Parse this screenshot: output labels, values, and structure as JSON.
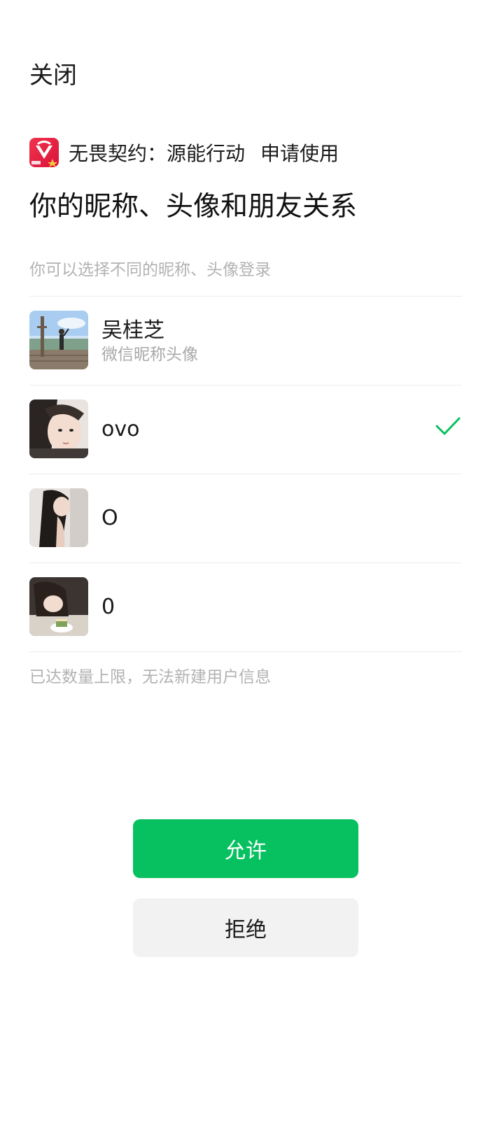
{
  "header": {
    "close_label": "关闭"
  },
  "app": {
    "name": "无畏契约：源能行动",
    "request_label": "申请使用",
    "icon": "valorant-app-icon",
    "icon_color": "#e8223f"
  },
  "title": "你的昵称、头像和朋友关系",
  "hint": "你可以选择不同的昵称、头像登录",
  "profiles": [
    {
      "name": "吴桂芝",
      "subtitle": "微信昵称头像",
      "selected": false
    },
    {
      "name": "ovo",
      "subtitle": "",
      "selected": true
    },
    {
      "name": "O",
      "subtitle": "",
      "selected": false
    },
    {
      "name": "0",
      "subtitle": "",
      "selected": false
    }
  ],
  "limit_note": "已达数量上限，无法新建用户信息",
  "buttons": {
    "allow_label": "允许",
    "reject_label": "拒绝"
  },
  "colors": {
    "accent": "#07c160",
    "check": "#07c160",
    "secondary_text": "#b2b2b2"
  }
}
